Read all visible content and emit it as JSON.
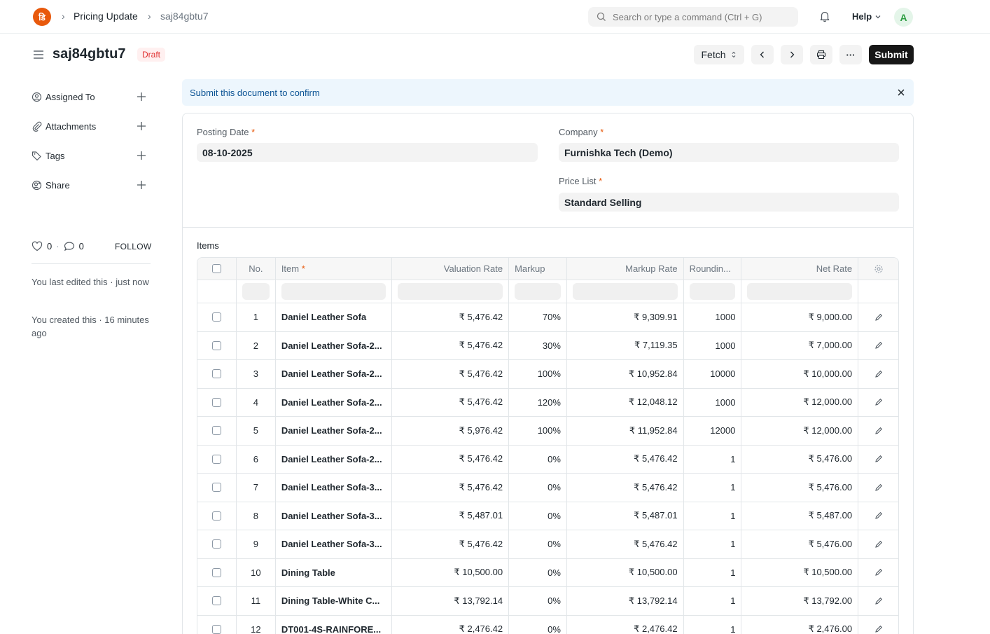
{
  "navbar": {
    "logo_glyph": "डि",
    "breadcrumbs": [
      "Pricing Update",
      "saj84gbtu7"
    ],
    "search_placeholder": "Search or type a command (Ctrl + G)",
    "help_label": "Help",
    "avatar_initial": "A"
  },
  "header": {
    "title": "saj84gbtu7",
    "status": "Draft",
    "fetch_label": "Fetch",
    "more_label": "···",
    "submit_label": "Submit"
  },
  "sidebar": {
    "items": [
      {
        "label": "Assigned To",
        "icon": "assign-icon"
      },
      {
        "label": "Attachments",
        "icon": "paperclip-icon"
      },
      {
        "label": "Tags",
        "icon": "tag-icon"
      },
      {
        "label": "Share",
        "icon": "share-icon"
      }
    ],
    "likes": "0",
    "comments": "0",
    "dot": "·",
    "follow_label": "FOLLOW",
    "last_edited": "You last edited this · just now",
    "created": "You created this · 16 minutes ago"
  },
  "alert": {
    "text": "Submit this document to confirm"
  },
  "form": {
    "posting_date_label": "Posting Date",
    "posting_date": "08-10-2025",
    "company_label": "Company",
    "company": "Furnishka Tech (Demo)",
    "price_list_label": "Price List",
    "price_list": "Standard Selling",
    "required_mark": "*"
  },
  "items_table": {
    "section_label": "Items",
    "columns": {
      "no": "No.",
      "item": "Item",
      "valuation_rate": "Valuation Rate",
      "markup": "Markup",
      "markup_rate": "Markup Rate",
      "rounding": "Roundin...",
      "net_rate": "Net Rate"
    },
    "rows": [
      {
        "no": "1",
        "item": "Daniel Leather Sofa",
        "valuation_rate": "₹ 5,476.42",
        "markup": "70%",
        "markup_rate": "₹ 9,309.91",
        "rounding": "1000",
        "net_rate": "₹ 9,000.00"
      },
      {
        "no": "2",
        "item": "Daniel Leather Sofa-2...",
        "valuation_rate": "₹ 5,476.42",
        "markup": "30%",
        "markup_rate": "₹ 7,119.35",
        "rounding": "1000",
        "net_rate": "₹ 7,000.00"
      },
      {
        "no": "3",
        "item": "Daniel Leather Sofa-2...",
        "valuation_rate": "₹ 5,476.42",
        "markup": "100%",
        "markup_rate": "₹ 10,952.84",
        "rounding": "10000",
        "net_rate": "₹ 10,000.00"
      },
      {
        "no": "4",
        "item": "Daniel Leather Sofa-2...",
        "valuation_rate": "₹ 5,476.42",
        "markup": "120%",
        "markup_rate": "₹ 12,048.12",
        "rounding": "1000",
        "net_rate": "₹ 12,000.00"
      },
      {
        "no": "5",
        "item": "Daniel Leather Sofa-2...",
        "valuation_rate": "₹ 5,976.42",
        "markup": "100%",
        "markup_rate": "₹ 11,952.84",
        "rounding": "12000",
        "net_rate": "₹ 12,000.00"
      },
      {
        "no": "6",
        "item": "Daniel Leather Sofa-2...",
        "valuation_rate": "₹ 5,476.42",
        "markup": "0%",
        "markup_rate": "₹ 5,476.42",
        "rounding": "1",
        "net_rate": "₹ 5,476.00"
      },
      {
        "no": "7",
        "item": "Daniel Leather Sofa-3...",
        "valuation_rate": "₹ 5,476.42",
        "markup": "0%",
        "markup_rate": "₹ 5,476.42",
        "rounding": "1",
        "net_rate": "₹ 5,476.00"
      },
      {
        "no": "8",
        "item": "Daniel Leather Sofa-3...",
        "valuation_rate": "₹ 5,487.01",
        "markup": "0%",
        "markup_rate": "₹ 5,487.01",
        "rounding": "1",
        "net_rate": "₹ 5,487.00"
      },
      {
        "no": "9",
        "item": "Daniel Leather Sofa-3...",
        "valuation_rate": "₹ 5,476.42",
        "markup": "0%",
        "markup_rate": "₹ 5,476.42",
        "rounding": "1",
        "net_rate": "₹ 5,476.00"
      },
      {
        "no": "10",
        "item": "Dining Table",
        "valuation_rate": "₹ 10,500.00",
        "markup": "0%",
        "markup_rate": "₹ 10,500.00",
        "rounding": "1",
        "net_rate": "₹ 10,500.00"
      },
      {
        "no": "11",
        "item": "Dining Table-White C...",
        "valuation_rate": "₹ 13,792.14",
        "markup": "0%",
        "markup_rate": "₹ 13,792.14",
        "rounding": "1",
        "net_rate": "₹ 13,792.00"
      },
      {
        "no": "12",
        "item": "DT001-4S-RAINFORE...",
        "valuation_rate": "₹ 2,476.42",
        "markup": "0%",
        "markup_rate": "₹ 2,476.42",
        "rounding": "1",
        "net_rate": "₹ 2,476.00"
      }
    ]
  },
  "colors": {
    "accent": "#e8590c",
    "draft_bg": "#fff0f0",
    "draft_text": "#e03131",
    "alert_bg": "#edf6fd",
    "alert_text": "#0b5394",
    "primary_button": "#171717"
  }
}
